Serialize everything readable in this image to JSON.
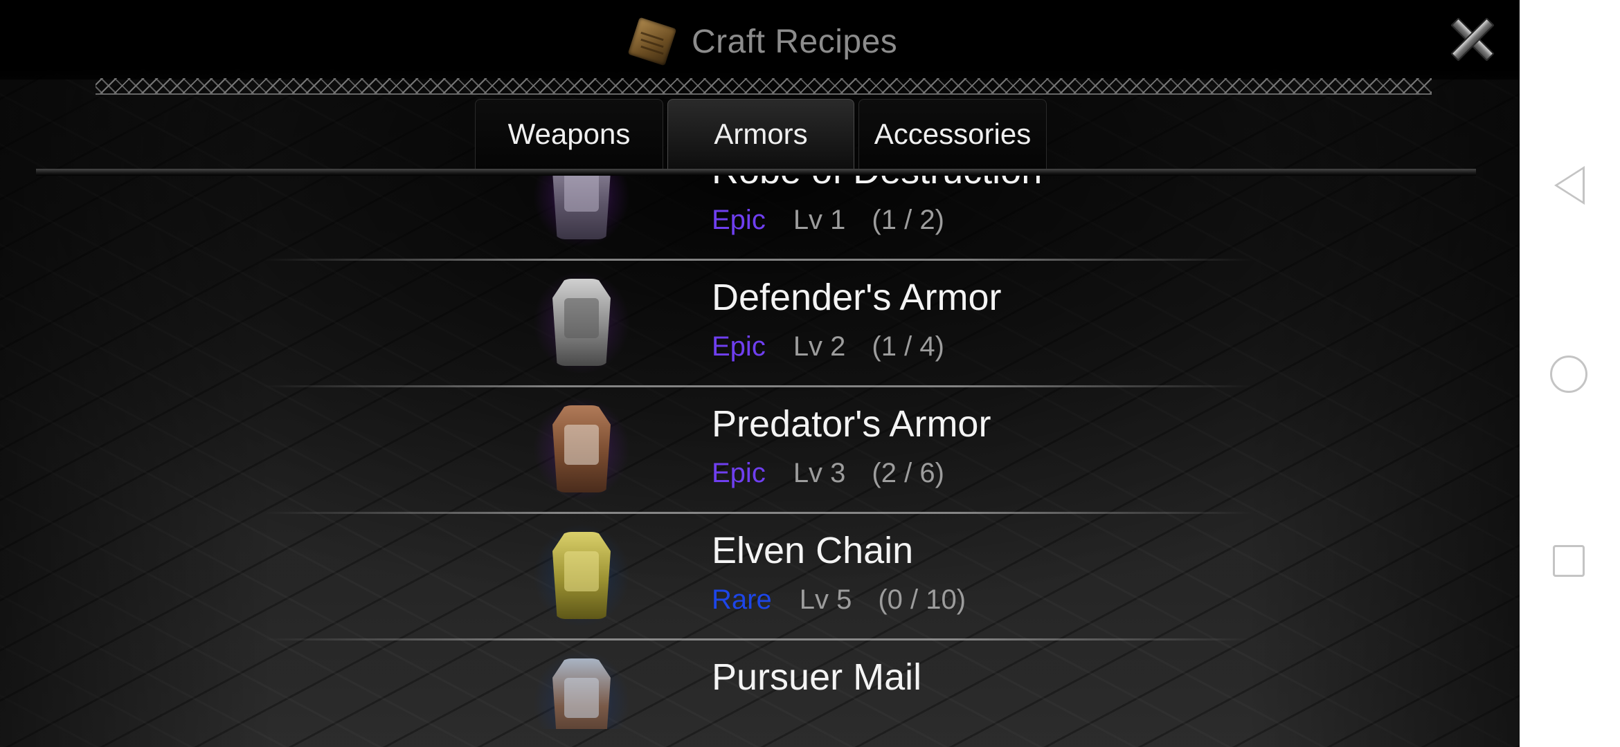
{
  "header": {
    "title": "Craft Recipes",
    "icon": "scroll-icon",
    "close_icon": "close-icon"
  },
  "tabs": [
    {
      "label": "Weapons",
      "active": false
    },
    {
      "label": "Armors",
      "active": true
    },
    {
      "label": "Accessories",
      "active": false
    }
  ],
  "recipes": [
    {
      "name": "Robe of Destruction",
      "rarity": "Epic",
      "level": "Lv 1",
      "count": "(1 / 2)",
      "icon": "robe-icon"
    },
    {
      "name": "Defender's Armor",
      "rarity": "Epic",
      "level": "Lv 2",
      "count": "(1 / 4)",
      "icon": "plate-armor-icon"
    },
    {
      "name": "Predator's Armor",
      "rarity": "Epic",
      "level": "Lv 3",
      "count": "(2 / 6)",
      "icon": "leather-armor-icon"
    },
    {
      "name": "Elven Chain",
      "rarity": "Rare",
      "level": "Lv 5",
      "count": "(0 / 10)",
      "icon": "chain-armor-icon"
    },
    {
      "name": "Pursuer Mail",
      "rarity": "",
      "level": "",
      "count": "",
      "icon": "mail-armor-icon"
    }
  ],
  "colors": {
    "epic": "#6f3ff0",
    "rare": "#1d46e8",
    "name": "#f4f4f4",
    "meta": "#9d9d9d",
    "robe_glow": "#6b2f9c",
    "defender_glow": "#5a2f80",
    "predator_glow": "#6a3390",
    "elven_glow": "#2d5f9a",
    "pursuer_glow": "#3a5fa6"
  },
  "system_nav": {
    "back_icon": "back-triangle-icon",
    "home_icon": "home-circle-icon",
    "recent_icon": "recent-square-icon"
  }
}
